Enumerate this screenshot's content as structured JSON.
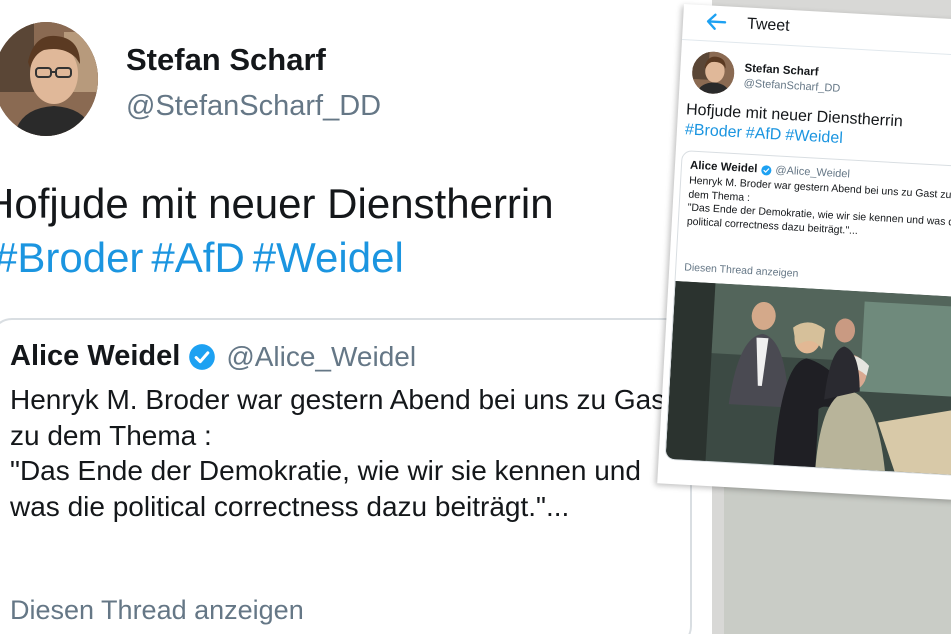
{
  "tweet": {
    "author_name": "Stefan Scharf",
    "author_handle": "@StefanScharf_DD",
    "text": "Hofjude mit neuer Dienstherrin",
    "hashtags": [
      "#Broder",
      "#AfD",
      "#Weidel"
    ]
  },
  "quoted_tweet": {
    "author_name": "Alice Weidel",
    "verified_icon": "verified-badge-icon",
    "author_handle": "@Alice_Weidel",
    "body": "Henryk M. Broder war gestern Abend bei uns zu Gast zu dem Thema :\n\"Das Ende der Demokratie, wie wir sie kennen und was die political correctness dazu beiträgt.\"...",
    "thread_link": "Diesen Thread anzeigen"
  },
  "small_screenshot": {
    "header_title": "Tweet",
    "back_icon": "arrow-left-icon",
    "author_name": "Stefan Scharf",
    "author_handle": "@StefanScharf_DD",
    "text": "Hofjude mit neuer Diensthеrrin",
    "hashtags": [
      "#Broder",
      "#AfD",
      "#Weidel"
    ],
    "quote_author_name": "Alice Weidel",
    "quote_author_handle": "@Alice_Weidel",
    "quote_body": "Henryk M. Broder war gestern Abend bei uns zu Gast zu dem Thema :\n\"Das Ende der Demokratie, wie wir sie kennen und was die political correctness dazu beiträgt.\"...",
    "quote_thread_link": "Diesen Thread anzeigen"
  },
  "colors": {
    "link_blue": "#1b95e0",
    "verified_blue": "#1da1f2",
    "secondary_text": "#657786",
    "primary_text": "#14171a"
  }
}
